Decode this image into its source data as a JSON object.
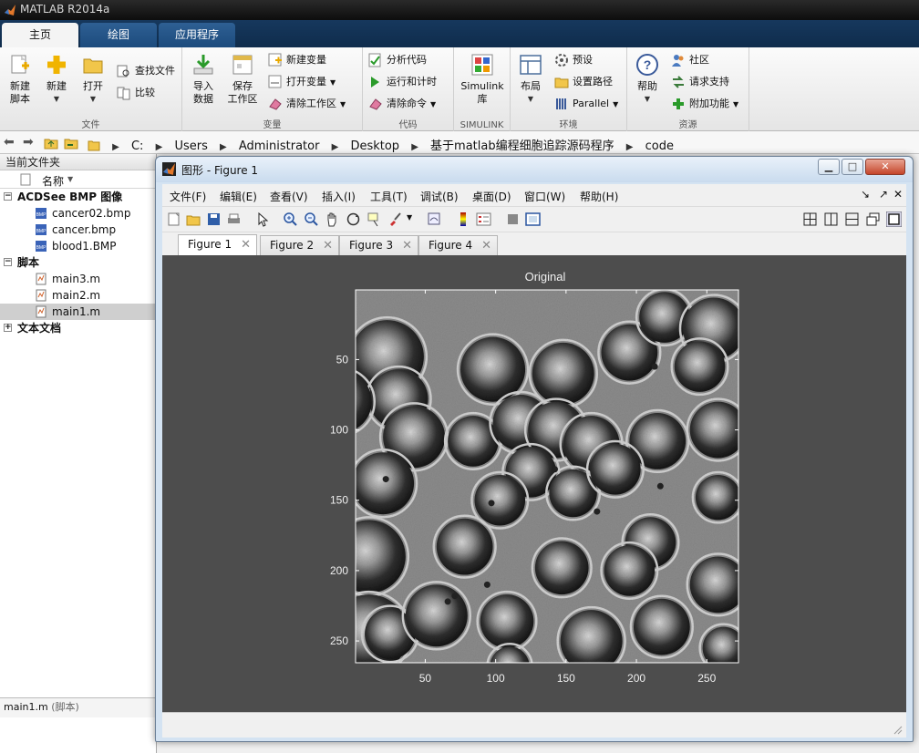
{
  "app": {
    "title": "MATLAB R2014a"
  },
  "ribbon_tabs": [
    {
      "label": "主页",
      "active": true
    },
    {
      "label": "绘图",
      "active": false
    },
    {
      "label": "应用程序",
      "active": false
    }
  ],
  "ribbon": {
    "file": {
      "name": "文件",
      "new_script": "新建\n脚本",
      "new_script_l1": "新建",
      "new_script_l2": "脚本",
      "new": "新建",
      "open": "打开",
      "find_files": "查找文件",
      "compare": "比较"
    },
    "variable": {
      "name": "变量",
      "import_l1": "导入",
      "import_l2": "数据",
      "save_l1": "保存",
      "save_l2": "工作区",
      "new_var": "新建变量",
      "open_var": "打开变量",
      "clear_ws": "清除工作区"
    },
    "code": {
      "name": "代码",
      "analyze": "分析代码",
      "run_time": "运行和计时",
      "clear_cmd": "清除命令"
    },
    "simulink": {
      "name": "SIMULINK",
      "lib_l1": "Simulink",
      "lib_l2": "库"
    },
    "environment": {
      "name": "环境",
      "layout": "布局",
      "prefs": "预设",
      "set_path": "设置路径",
      "parallel": "Parallel"
    },
    "resources": {
      "name": "资源",
      "help": "帮助",
      "community": "社区",
      "support": "请求支持",
      "addons": "附加功能"
    }
  },
  "address": {
    "crumbs": [
      "C:",
      "Users",
      "Administrator",
      "Desktop",
      "基于matlab编程细胞追踪源码程序",
      "code"
    ]
  },
  "folder_panel": {
    "title": "当前文件夹",
    "column": "名称",
    "groups": [
      {
        "label": "ACDSee BMP 图像",
        "expanded": true,
        "files": [
          "cancer02.bmp",
          "cancer.bmp",
          "blood1.BMP"
        ]
      },
      {
        "label": "脚本",
        "expanded": true,
        "files": [
          "main3.m",
          "main2.m",
          "main1.m"
        ]
      },
      {
        "label": "文本文档",
        "expanded": false,
        "files": []
      }
    ],
    "selected_file": "main1.m",
    "detail_name": "main1.m",
    "detail_kind": "(脚本)"
  },
  "figure_window": {
    "title": "图形 - Figure 1",
    "menu": [
      "文件(F)",
      "编辑(E)",
      "查看(V)",
      "插入(I)",
      "工具(T)",
      "调试(B)",
      "桌面(D)",
      "窗口(W)",
      "帮助(H)"
    ],
    "tabs": [
      "Figure 1",
      "Figure 2",
      "Figure 3",
      "Figure 4"
    ],
    "active_tab": "Figure 1"
  },
  "chart_data": {
    "type": "heatmap",
    "title": "Original",
    "xlabel": "",
    "ylabel": "",
    "xlim": [
      0.5,
      272.5
    ],
    "ylim": [
      0.5,
      265.5
    ],
    "xticks": [
      50,
      100,
      150,
      200,
      250
    ],
    "yticks": [
      50,
      100,
      150,
      200,
      250
    ],
    "y_direction": "reversed",
    "colormap": "gray",
    "cells": [
      [
        23,
        48,
        26
      ],
      [
        31,
        78,
        21
      ],
      [
        -10,
        80,
        22
      ],
      [
        98,
        57,
        23
      ],
      [
        148,
        60,
        22
      ],
      [
        195,
        45,
        20
      ],
      [
        220,
        20,
        18
      ],
      [
        255,
        28,
        22
      ],
      [
        245,
        55,
        18
      ],
      [
        42,
        105,
        22
      ],
      [
        84,
        108,
        18
      ],
      [
        118,
        95,
        20
      ],
      [
        143,
        100,
        20
      ],
      [
        168,
        110,
        20
      ],
      [
        215,
        108,
        20
      ],
      [
        258,
        100,
        20
      ],
      [
        125,
        130,
        18
      ],
      [
        155,
        145,
        17
      ],
      [
        103,
        150,
        18
      ],
      [
        185,
        128,
        18
      ],
      [
        258,
        148,
        16
      ],
      [
        20,
        138,
        22
      ],
      [
        10,
        190,
        26
      ],
      [
        10,
        245,
        28
      ],
      [
        25,
        245,
        18
      ],
      [
        78,
        183,
        20
      ],
      [
        147,
        198,
        19
      ],
      [
        210,
        180,
        18
      ],
      [
        195,
        200,
        18
      ],
      [
        258,
        210,
        20
      ],
      [
        58,
        232,
        22
      ],
      [
        108,
        236,
        19
      ],
      [
        168,
        250,
        22
      ],
      [
        218,
        240,
        20
      ],
      [
        262,
        255,
        15
      ],
      [
        110,
        268,
        14
      ]
    ],
    "dark_dots": [
      [
        213,
        55
      ],
      [
        142,
        128
      ],
      [
        94,
        210
      ],
      [
        66,
        222
      ],
      [
        71,
        218
      ],
      [
        97,
        152
      ],
      [
        172,
        158
      ],
      [
        22,
        135
      ],
      [
        217,
        140
      ]
    ]
  }
}
